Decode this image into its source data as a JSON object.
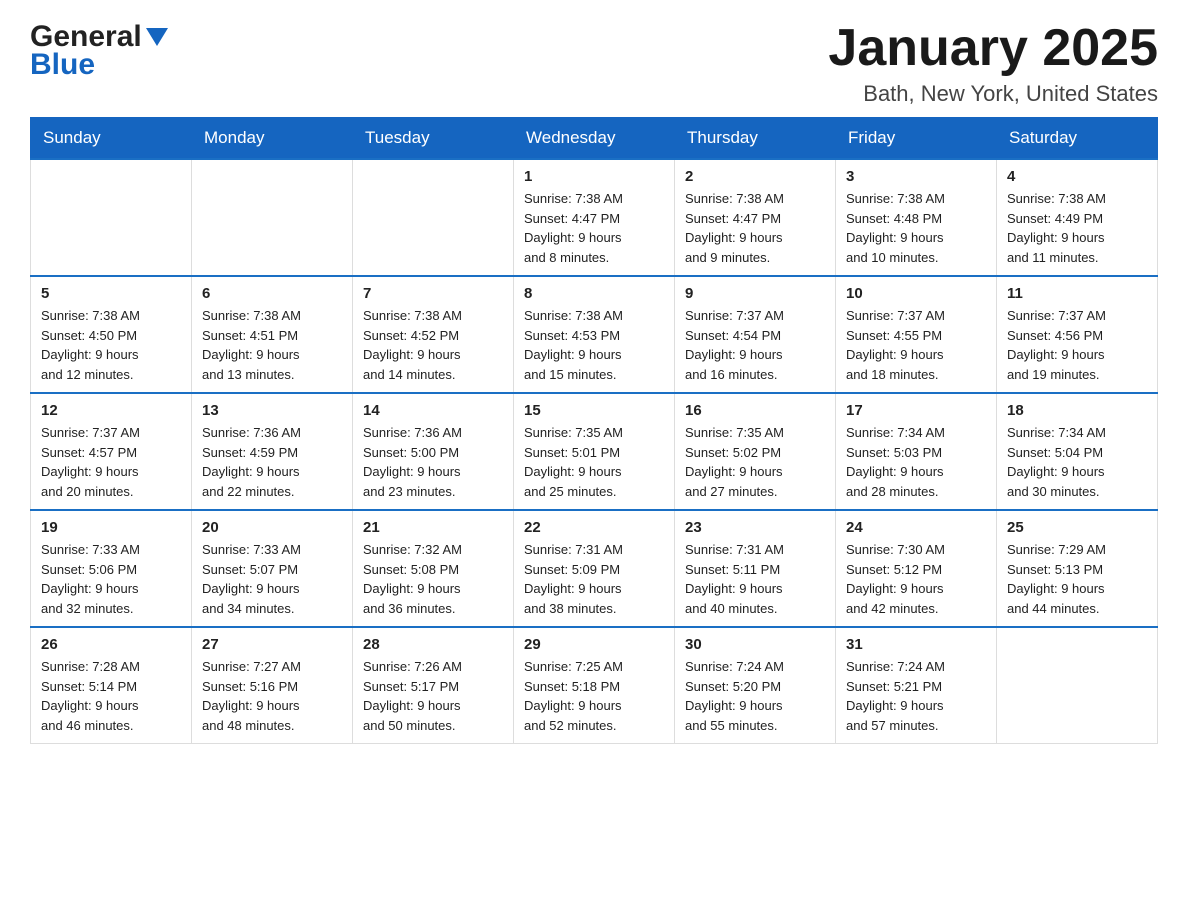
{
  "logo": {
    "general": "General",
    "blue": "Blue",
    "arrow": "▼"
  },
  "header": {
    "month": "January 2025",
    "location": "Bath, New York, United States"
  },
  "days_of_week": [
    "Sunday",
    "Monday",
    "Tuesday",
    "Wednesday",
    "Thursday",
    "Friday",
    "Saturday"
  ],
  "weeks": [
    [
      {
        "day": "",
        "info": ""
      },
      {
        "day": "",
        "info": ""
      },
      {
        "day": "",
        "info": ""
      },
      {
        "day": "1",
        "info": "Sunrise: 7:38 AM\nSunset: 4:47 PM\nDaylight: 9 hours\nand 8 minutes."
      },
      {
        "day": "2",
        "info": "Sunrise: 7:38 AM\nSunset: 4:47 PM\nDaylight: 9 hours\nand 9 minutes."
      },
      {
        "day": "3",
        "info": "Sunrise: 7:38 AM\nSunset: 4:48 PM\nDaylight: 9 hours\nand 10 minutes."
      },
      {
        "day": "4",
        "info": "Sunrise: 7:38 AM\nSunset: 4:49 PM\nDaylight: 9 hours\nand 11 minutes."
      }
    ],
    [
      {
        "day": "5",
        "info": "Sunrise: 7:38 AM\nSunset: 4:50 PM\nDaylight: 9 hours\nand 12 minutes."
      },
      {
        "day": "6",
        "info": "Sunrise: 7:38 AM\nSunset: 4:51 PM\nDaylight: 9 hours\nand 13 minutes."
      },
      {
        "day": "7",
        "info": "Sunrise: 7:38 AM\nSunset: 4:52 PM\nDaylight: 9 hours\nand 14 minutes."
      },
      {
        "day": "8",
        "info": "Sunrise: 7:38 AM\nSunset: 4:53 PM\nDaylight: 9 hours\nand 15 minutes."
      },
      {
        "day": "9",
        "info": "Sunrise: 7:37 AM\nSunset: 4:54 PM\nDaylight: 9 hours\nand 16 minutes."
      },
      {
        "day": "10",
        "info": "Sunrise: 7:37 AM\nSunset: 4:55 PM\nDaylight: 9 hours\nand 18 minutes."
      },
      {
        "day": "11",
        "info": "Sunrise: 7:37 AM\nSunset: 4:56 PM\nDaylight: 9 hours\nand 19 minutes."
      }
    ],
    [
      {
        "day": "12",
        "info": "Sunrise: 7:37 AM\nSunset: 4:57 PM\nDaylight: 9 hours\nand 20 minutes."
      },
      {
        "day": "13",
        "info": "Sunrise: 7:36 AM\nSunset: 4:59 PM\nDaylight: 9 hours\nand 22 minutes."
      },
      {
        "day": "14",
        "info": "Sunrise: 7:36 AM\nSunset: 5:00 PM\nDaylight: 9 hours\nand 23 minutes."
      },
      {
        "day": "15",
        "info": "Sunrise: 7:35 AM\nSunset: 5:01 PM\nDaylight: 9 hours\nand 25 minutes."
      },
      {
        "day": "16",
        "info": "Sunrise: 7:35 AM\nSunset: 5:02 PM\nDaylight: 9 hours\nand 27 minutes."
      },
      {
        "day": "17",
        "info": "Sunrise: 7:34 AM\nSunset: 5:03 PM\nDaylight: 9 hours\nand 28 minutes."
      },
      {
        "day": "18",
        "info": "Sunrise: 7:34 AM\nSunset: 5:04 PM\nDaylight: 9 hours\nand 30 minutes."
      }
    ],
    [
      {
        "day": "19",
        "info": "Sunrise: 7:33 AM\nSunset: 5:06 PM\nDaylight: 9 hours\nand 32 minutes."
      },
      {
        "day": "20",
        "info": "Sunrise: 7:33 AM\nSunset: 5:07 PM\nDaylight: 9 hours\nand 34 minutes."
      },
      {
        "day": "21",
        "info": "Sunrise: 7:32 AM\nSunset: 5:08 PM\nDaylight: 9 hours\nand 36 minutes."
      },
      {
        "day": "22",
        "info": "Sunrise: 7:31 AM\nSunset: 5:09 PM\nDaylight: 9 hours\nand 38 minutes."
      },
      {
        "day": "23",
        "info": "Sunrise: 7:31 AM\nSunset: 5:11 PM\nDaylight: 9 hours\nand 40 minutes."
      },
      {
        "day": "24",
        "info": "Sunrise: 7:30 AM\nSunset: 5:12 PM\nDaylight: 9 hours\nand 42 minutes."
      },
      {
        "day": "25",
        "info": "Sunrise: 7:29 AM\nSunset: 5:13 PM\nDaylight: 9 hours\nand 44 minutes."
      }
    ],
    [
      {
        "day": "26",
        "info": "Sunrise: 7:28 AM\nSunset: 5:14 PM\nDaylight: 9 hours\nand 46 minutes."
      },
      {
        "day": "27",
        "info": "Sunrise: 7:27 AM\nSunset: 5:16 PM\nDaylight: 9 hours\nand 48 minutes."
      },
      {
        "day": "28",
        "info": "Sunrise: 7:26 AM\nSunset: 5:17 PM\nDaylight: 9 hours\nand 50 minutes."
      },
      {
        "day": "29",
        "info": "Sunrise: 7:25 AM\nSunset: 5:18 PM\nDaylight: 9 hours\nand 52 minutes."
      },
      {
        "day": "30",
        "info": "Sunrise: 7:24 AM\nSunset: 5:20 PM\nDaylight: 9 hours\nand 55 minutes."
      },
      {
        "day": "31",
        "info": "Sunrise: 7:24 AM\nSunset: 5:21 PM\nDaylight: 9 hours\nand 57 minutes."
      },
      {
        "day": "",
        "info": ""
      }
    ]
  ]
}
